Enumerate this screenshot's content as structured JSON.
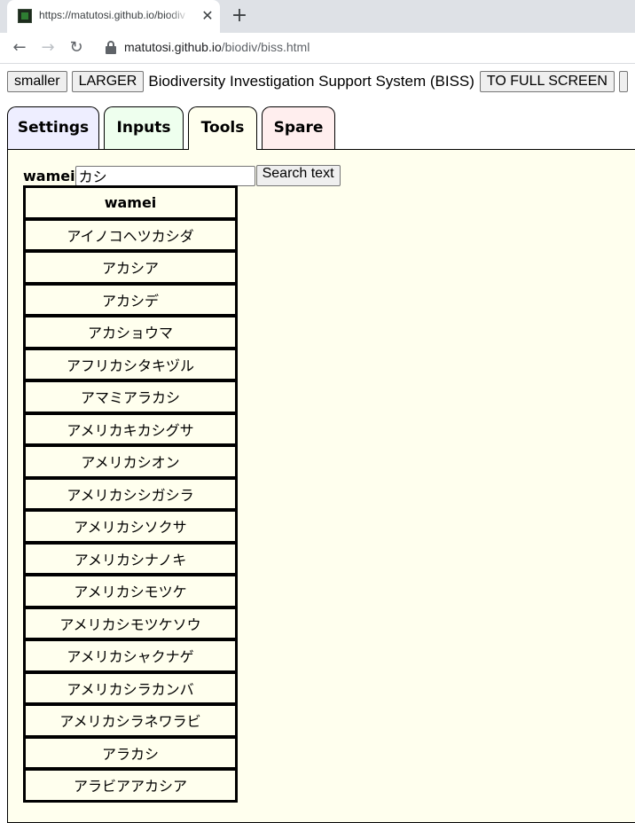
{
  "browser": {
    "tab_title": "https://matutosi.github.io/biodiv",
    "close_glyph": "✕",
    "new_tab_glyph": "+",
    "url_host": "matutosi.github.io",
    "url_path": "/biodiv/biss.html",
    "icons": {
      "back": "back-arrow-icon",
      "forward": "forward-arrow-icon",
      "reload": "reload-icon",
      "lock": "lock-icon"
    }
  },
  "topbar": {
    "smaller_label": "smaller",
    "larger_label": "LARGER",
    "title": "Biodiversity Investigation Support System (BISS)",
    "fullscreen_label": "TO FULL SCREEN"
  },
  "tabs": [
    {
      "label": "Settings",
      "color": "#eeeeff"
    },
    {
      "label": "Inputs",
      "color": "#eeffee"
    },
    {
      "label": "Tools",
      "color": "#ffffee"
    },
    {
      "label": "Spare",
      "color": "#ffeeee"
    }
  ],
  "active_tab": "Tools",
  "tools": {
    "search_label": "wamei",
    "search_value": "カシ",
    "search_button": "Search text",
    "table_header": "wamei",
    "results": [
      "アイノコヘツカシダ",
      "アカシア",
      "アカシデ",
      "アカショウマ",
      "アフリカシタキヅル",
      "アマミアラカシ",
      "アメリカキカシグサ",
      "アメリカシオン",
      "アメリカシシガシラ",
      "アメリカシソクサ",
      "アメリカシナノキ",
      "アメリカシモツケ",
      "アメリカシモツケソウ",
      "アメリカシャクナゲ",
      "アメリカシラカンバ",
      "アメリカシラネワラビ",
      "アラカシ",
      "アラビアアカシア"
    ]
  }
}
